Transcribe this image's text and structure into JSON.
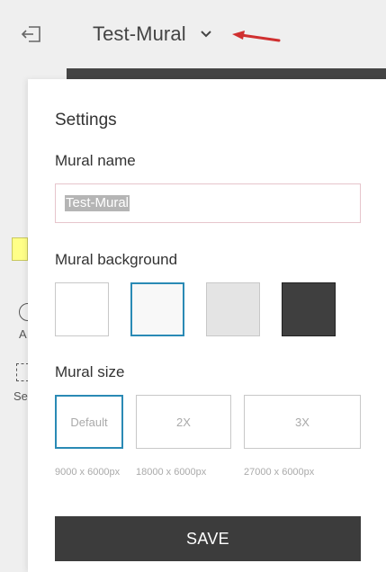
{
  "header": {
    "title": "Test-Mural",
    "exit_icon": "exit-icon",
    "dropdown_icon": "chevron-down-icon",
    "annotation_arrow_color": "#d03030"
  },
  "left_rail": {
    "label_a": "A",
    "label_se": "Se"
  },
  "settings": {
    "heading": "Settings",
    "name_label": "Mural name",
    "name_value": "Test-Mural",
    "background_label": "Mural background",
    "backgrounds": [
      {
        "color": "#ffffff",
        "selected": false
      },
      {
        "color": "#f8f8f8",
        "selected": true
      },
      {
        "color": "#e4e4e4",
        "selected": false
      },
      {
        "color": "#3f3f3f",
        "selected": false
      }
    ],
    "size_label": "Mural size",
    "sizes": [
      {
        "label": "Default",
        "caption": "9000 x 6000px",
        "selected": true
      },
      {
        "label": "2X",
        "caption": "18000 x 6000px",
        "selected": false
      },
      {
        "label": "3X",
        "caption": "27000 x 6000px",
        "selected": false
      }
    ],
    "save_label": "SAVE"
  },
  "colors": {
    "accent": "#2a8ab5",
    "save_button": "#3c3c3c",
    "panel": "#ffffff",
    "app_background": "#efefef"
  }
}
